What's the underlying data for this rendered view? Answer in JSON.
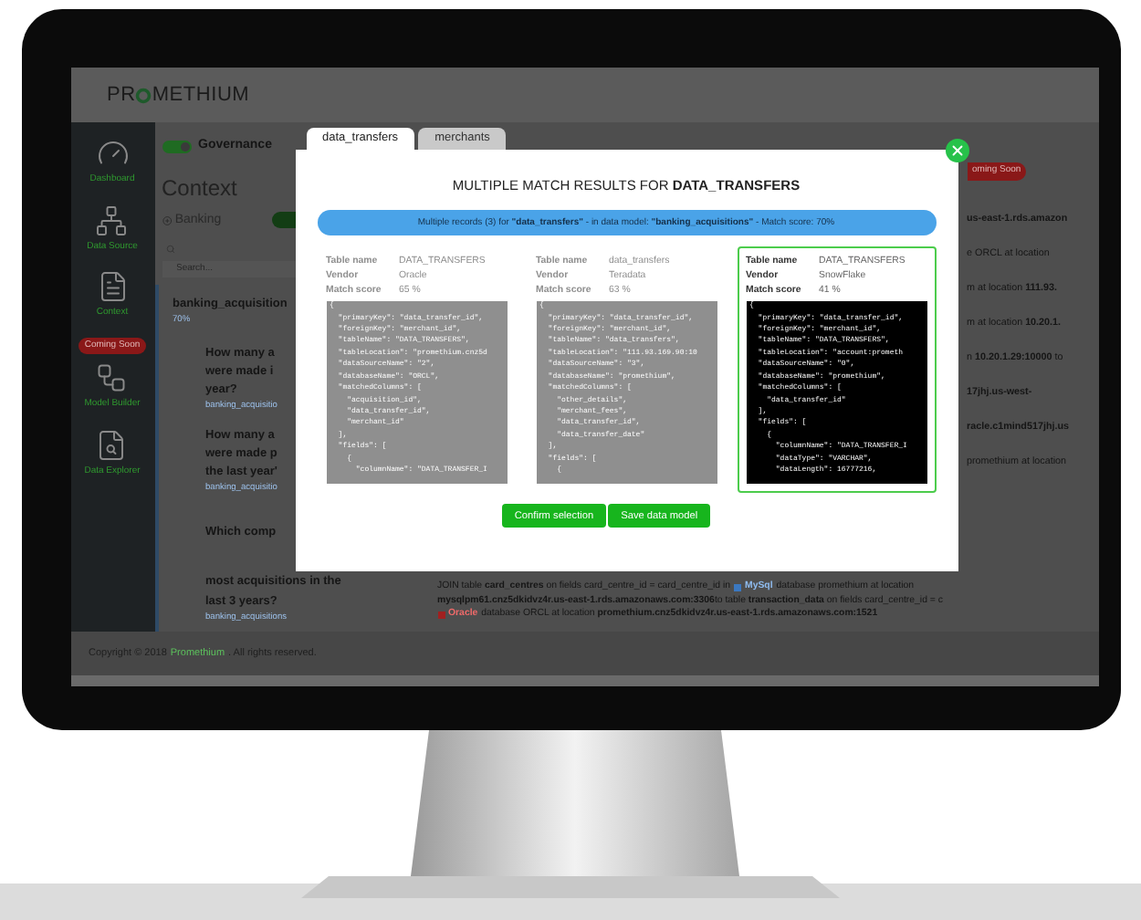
{
  "app": {
    "logo_start": "PR",
    "logo_end": "METHIUM"
  },
  "sidebar": {
    "items": [
      {
        "label": "Dashboard"
      },
      {
        "label": "Data Source"
      },
      {
        "label": "Context"
      },
      {
        "label": "Model Builder",
        "badge": "Coming Soon"
      },
      {
        "label": "Data Explorer"
      }
    ]
  },
  "governance": {
    "label": "Governance",
    "on": true
  },
  "context_title": "Context",
  "breadcrumb": "Banking",
  "search": {
    "placeholder": "Search..."
  },
  "model": {
    "name": "banking_acquisition",
    "score": "70%"
  },
  "questions": [
    {
      "lines": [
        "How many a",
        "were made i",
        "year?"
      ],
      "tag": "banking_acquisitio"
    },
    {
      "lines": [
        "How many a",
        "were made p",
        "the last year'"
      ],
      "tag": "banking_acquisitio"
    }
  ],
  "last_question": {
    "first_line": "Which comp",
    "more_lines": [
      "most acquisitions in the",
      "last 3 years?"
    ],
    "tag": "banking_acquisitions"
  },
  "right_fragments": [
    {
      "text": "oming Soon",
      "kind": "badge"
    },
    {
      "text": "**us-east-1.rds.amazon**",
      "kind": "text"
    },
    {
      "text": "e ORCL at location",
      "kind": "text"
    },
    {
      "text": "m at location **111.93.**",
      "kind": "text"
    },
    {
      "text": "m at location **10.20.1.**",
      "kind": "text"
    },
    {
      "text": "n **10.20.1.29:10000** to",
      "kind": "text"
    },
    {
      "text": "**17jhj.us-west-**",
      "kind": "text"
    },
    {
      "text": "**racle.c1mind517jhj.us**",
      "kind": "text"
    },
    {
      "text": "promethium at location",
      "kind": "text"
    }
  ],
  "join_text": {
    "line1_start": "JOIN table **card_centres** on fields card_centre_id = card_centre_id in",
    "mysql": "MySql",
    "line1_end": "database promethium at location",
    "line2": "**mysqlpm61.cnz5dkidvz4r.us-east-1.rds.amazonaws.com:3306**to table **transaction_data** on fields card_centre_id = c",
    "oracle": "Oracle",
    "line3_end": "database ORCL at location **promethium.cnz5dkidvz4r.us-east-1.rds.amazonaws.com:1521**"
  },
  "footer": {
    "start": "Copyright © 2018",
    "link": "Promethium",
    "end": ". All rights reserved."
  },
  "modal": {
    "tabs": [
      {
        "label": "data_transfers",
        "selected": true
      },
      {
        "label": "merchants",
        "selected": false
      }
    ],
    "title": "MULTIPLE MATCH RESULTS FOR **DATA_TRANSFERS**",
    "banner": "Multiple records (3) for **\"data_transfers\"** - in data model: **\"banking_acquisitions\"** - Match score: 70%",
    "candidates": [
      {
        "selected": false,
        "rows": [
          {
            "label": "Table name",
            "value": "DATA_TRANSFERS"
          },
          {
            "label": "Vendor",
            "value": "Oracle"
          },
          {
            "label": "Match score",
            "value": "65 %"
          }
        ],
        "code": "{\n  \"primaryKey\": \"data_transfer_id\",\n  \"foreignKey\": \"merchant_id\",\n  \"tableName\": \"DATA_TRANSFERS\",\n  \"tableLocation\": \"promethium.cnz5d\n  \"dataSourceName\": \"2\",\n  \"databaseName\": \"ORCL\",\n  \"matchedColumns\": [\n    \"acquisition_id\",\n    \"data_transfer_id\",\n    \"merchant_id\"\n  ],\n  \"fields\": [\n    {\n      \"columnName\": \"DATA_TRANSFER_I"
      },
      {
        "selected": false,
        "rows": [
          {
            "label": "Table name",
            "value": "data_transfers"
          },
          {
            "label": "Vendor",
            "value": "Teradata"
          },
          {
            "label": "Match score",
            "value": "63 %"
          }
        ],
        "code": "{\n  \"primaryKey\": \"data_transfer_id\",\n  \"foreignKey\": \"merchant_id\",\n  \"tableName\": \"data_transfers\",\n  \"tableLocation\": \"111.93.169.90:10\n  \"dataSourceName\": \"3\",\n  \"databaseName\": \"promethium\",\n  \"matchedColumns\": [\n    \"other_details\",\n    \"merchant_fees\",\n    \"data_transfer_id\",\n    \"data_transfer_date\"\n  ],\n  \"fields\": [\n    {"
      },
      {
        "selected": true,
        "rows": [
          {
            "label": "Table name",
            "value": "DATA_TRANSFERS"
          },
          {
            "label": "Vendor",
            "value": "SnowFlake"
          },
          {
            "label": "Match score",
            "value": "41 %"
          }
        ],
        "code": "{\n  \"primaryKey\": \"data_transfer_id\",\n  \"foreignKey\": \"merchant_id\",\n  \"tableName\": \"DATA_TRANSFERS\",\n  \"tableLocation\": \"account:prometh\n  \"dataSourceName\": \"0\",\n  \"databaseName\": \"promethium\",\n  \"matchedColumns\": [\n    \"data_transfer_id\"\n  ],\n  \"fields\": [\n    {\n      \"columnName\": \"DATA_TRANSFER_I\n      \"dataType\": \"VARCHAR\",\n      \"dataLength\": 16777216,"
      }
    ],
    "buttons": [
      "Confirm selection",
      "Save data model"
    ]
  }
}
